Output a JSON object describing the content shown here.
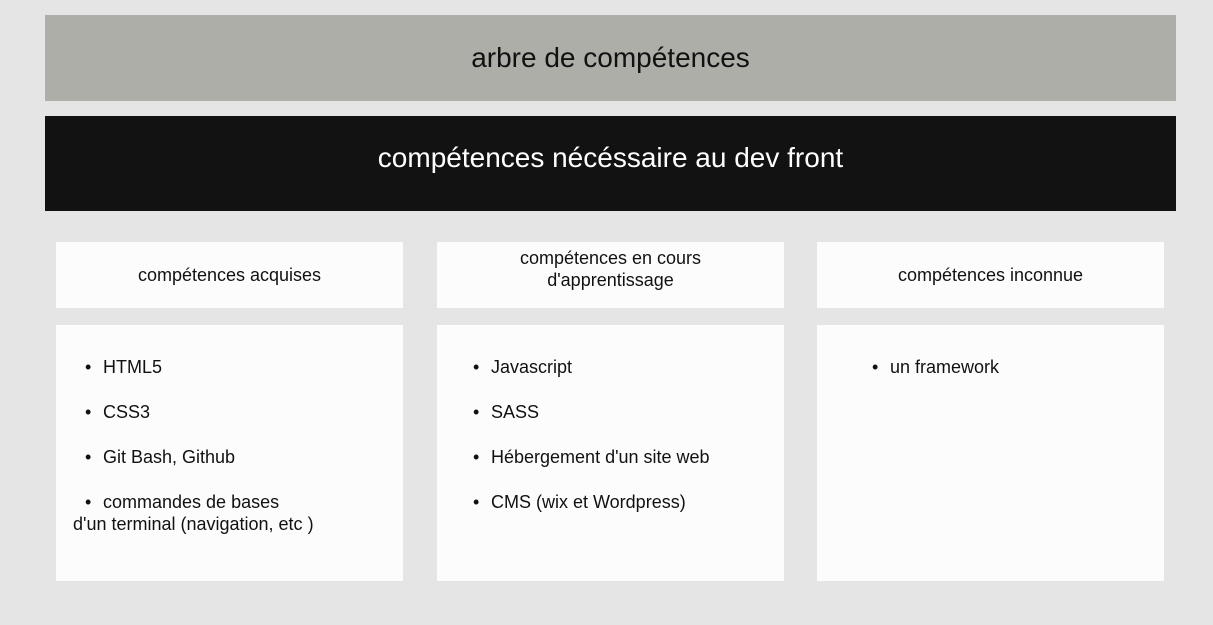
{
  "header": {
    "title": "arbre de compétences",
    "subtitle": "compétences nécéssaire au dev front"
  },
  "columns": [
    {
      "heading": "compétences acquises",
      "items": [
        "HTML5",
        "CSS3",
        "Git Bash, Github",
        "commandes de bases",
        "d'un terminal (navigation, etc )"
      ]
    },
    {
      "heading_line1": "compétences en cours",
      "heading_line2": "d'apprentissage",
      "items": [
        "Javascript",
        "SASS",
        "Hébergement d'un site web",
        "CMS (wix et Wordpress)"
      ]
    },
    {
      "heading": "compétences inconnue",
      "items": [
        "un framework"
      ]
    }
  ],
  "bullet_symbol": "•"
}
